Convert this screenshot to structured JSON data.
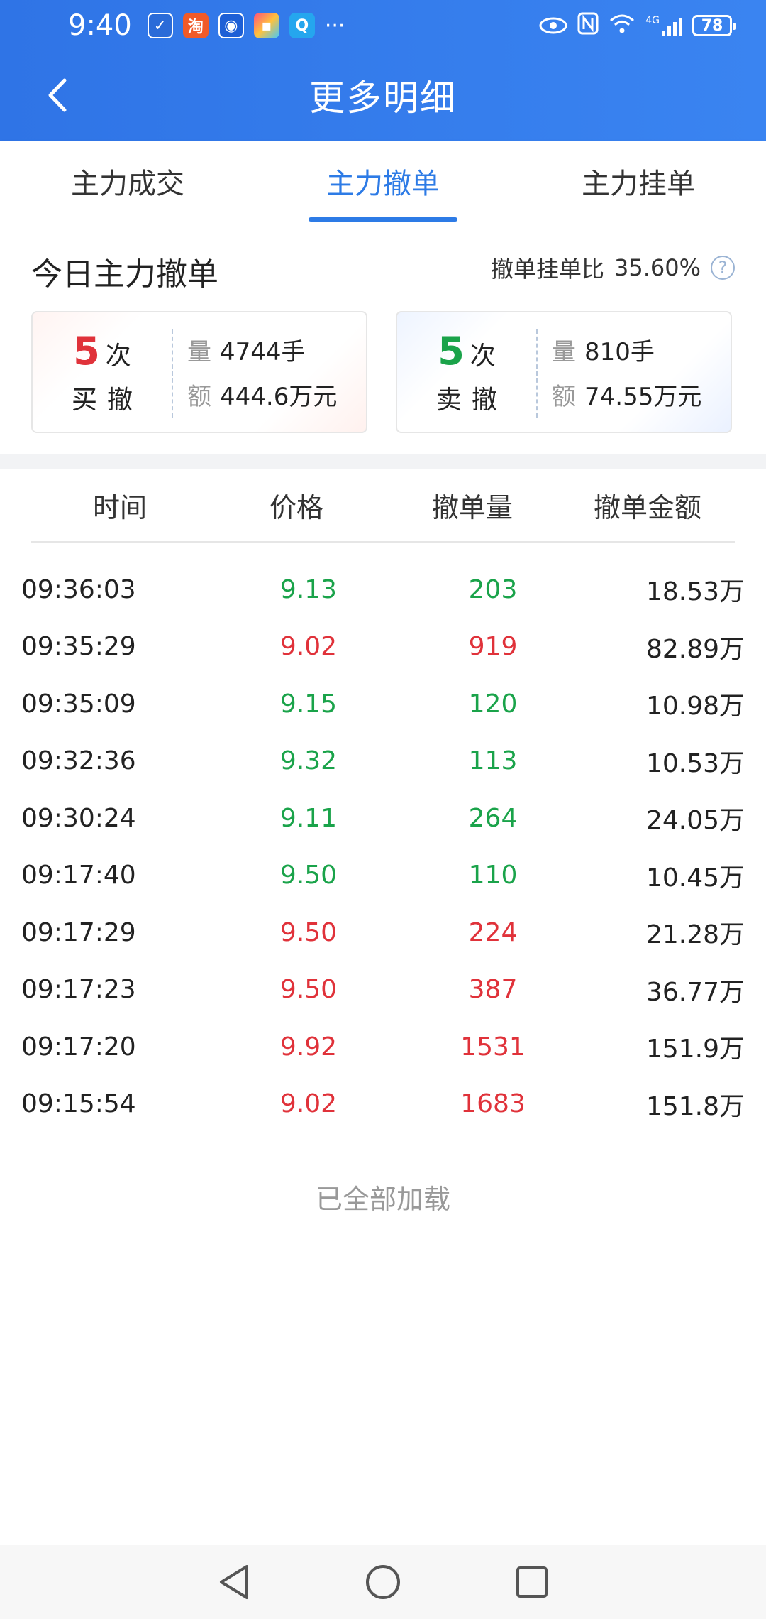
{
  "status": {
    "time": "9:40",
    "battery": "78",
    "signal": "4G"
  },
  "header": {
    "title": "更多明细"
  },
  "tabs": [
    {
      "label": "主力成交",
      "active": false
    },
    {
      "label": "主力撤单",
      "active": true
    },
    {
      "label": "主力挂单",
      "active": false
    }
  ],
  "summary": {
    "title": "今日主力撤单",
    "ratio_label": "撤单挂单比",
    "ratio_value": "35.60%",
    "buy": {
      "count": "5",
      "count_unit": "次",
      "type": "买撤",
      "vol_label": "量",
      "vol": "4744手",
      "amt_label": "额",
      "amt": "444.6万元"
    },
    "sell": {
      "count": "5",
      "count_unit": "次",
      "type": "卖撤",
      "vol_label": "量",
      "vol": "810手",
      "amt_label": "额",
      "amt": "74.55万元"
    }
  },
  "table": {
    "headers": [
      "时间",
      "价格",
      "撤单量",
      "撤单金额"
    ],
    "rows": [
      {
        "time": "09:36:03",
        "price": "9.13",
        "vol": "203",
        "amt": "18.53万",
        "dir": "down"
      },
      {
        "time": "09:35:29",
        "price": "9.02",
        "vol": "919",
        "amt": "82.89万",
        "dir": "up"
      },
      {
        "time": "09:35:09",
        "price": "9.15",
        "vol": "120",
        "amt": "10.98万",
        "dir": "down"
      },
      {
        "time": "09:32:36",
        "price": "9.32",
        "vol": "113",
        "amt": "10.53万",
        "dir": "down"
      },
      {
        "time": "09:30:24",
        "price": "9.11",
        "vol": "264",
        "amt": "24.05万",
        "dir": "down"
      },
      {
        "time": "09:17:40",
        "price": "9.50",
        "vol": "110",
        "amt": "10.45万",
        "dir": "down"
      },
      {
        "time": "09:17:29",
        "price": "9.50",
        "vol": "224",
        "amt": "21.28万",
        "dir": "up"
      },
      {
        "time": "09:17:23",
        "price": "9.50",
        "vol": "387",
        "amt": "36.77万",
        "dir": "up"
      },
      {
        "time": "09:17:20",
        "price": "9.92",
        "vol": "1531",
        "amt": "151.9万",
        "dir": "up"
      },
      {
        "time": "09:15:54",
        "price": "9.02",
        "vol": "1683",
        "amt": "151.8万",
        "dir": "up"
      }
    ]
  },
  "footer_text": "已全部加载",
  "colors": {
    "header_blue": "#2f74e6",
    "up_red": "#e0323a",
    "down_green": "#1aa34a",
    "tab_active": "#2d7be6"
  }
}
